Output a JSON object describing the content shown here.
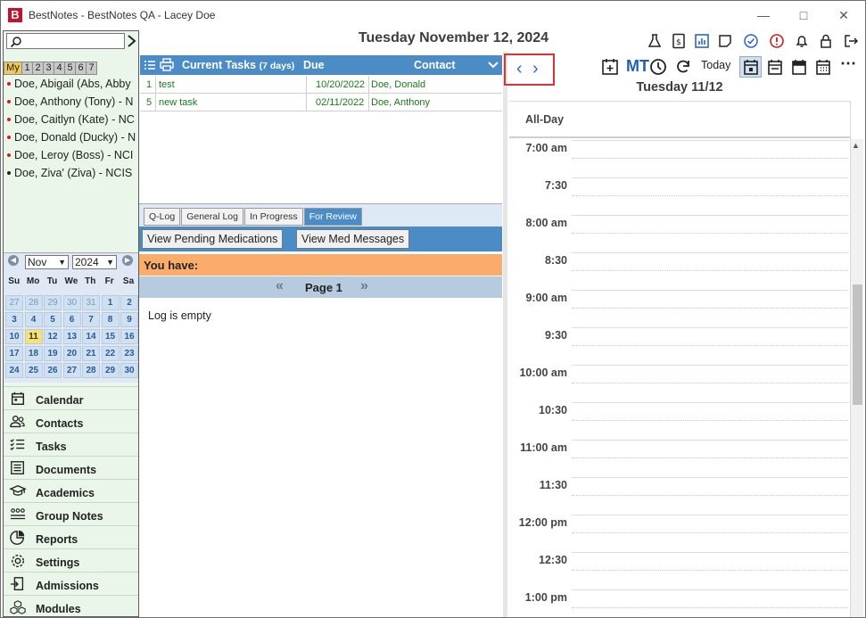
{
  "window": {
    "title": "BestNotes - BestNotes QA - Lacey Doe",
    "logo": "B"
  },
  "header": {
    "date": "Tuesday November 12, 2024",
    "icons": [
      "flask-icon",
      "billing-icon",
      "chart-icon",
      "note-icon",
      "check-circle-icon",
      "info-icon",
      "bell-icon",
      "lock-icon",
      "logout-icon"
    ]
  },
  "sidebar": {
    "search_placeholder": "",
    "tabs": [
      "My",
      "1",
      "2",
      "3",
      "4",
      "5",
      "6",
      "7"
    ],
    "contacts": [
      {
        "name": "Doe, Abigail (Abs, Abby",
        "dot": "#d02020"
      },
      {
        "name": "Doe, Anthony (Tony) - N",
        "dot": "#d02020"
      },
      {
        "name": "Doe, Caitlyn (Kate) - NC",
        "dot": "#d02020"
      },
      {
        "name": "Doe, Donald (Ducky) - N",
        "dot": "#d02020"
      },
      {
        "name": "Doe, Leroy (Boss) - NCI",
        "dot": "#d02020"
      },
      {
        "name": "Doe, Ziva' (Ziva) - NCIS",
        "dot": "#222222"
      }
    ],
    "calendar": {
      "month": "Nov",
      "year": "2024",
      "weekdays": [
        "Su",
        "Mo",
        "Tu",
        "We",
        "Th",
        "Fr",
        "Sa"
      ],
      "days": [
        {
          "d": "27",
          "other": true
        },
        {
          "d": "28",
          "other": true
        },
        {
          "d": "29",
          "other": true
        },
        {
          "d": "30",
          "other": true
        },
        {
          "d": "31",
          "other": true
        },
        {
          "d": "1"
        },
        {
          "d": "2"
        },
        {
          "d": "3"
        },
        {
          "d": "4"
        },
        {
          "d": "5"
        },
        {
          "d": "6"
        },
        {
          "d": "7"
        },
        {
          "d": "8"
        },
        {
          "d": "9"
        },
        {
          "d": "10"
        },
        {
          "d": "11",
          "today": true
        },
        {
          "d": "12"
        },
        {
          "d": "13"
        },
        {
          "d": "14"
        },
        {
          "d": "15"
        },
        {
          "d": "16"
        },
        {
          "d": "17"
        },
        {
          "d": "18"
        },
        {
          "d": "19"
        },
        {
          "d": "20"
        },
        {
          "d": "21"
        },
        {
          "d": "22"
        },
        {
          "d": "23"
        },
        {
          "d": "24"
        },
        {
          "d": "25"
        },
        {
          "d": "26"
        },
        {
          "d": "27"
        },
        {
          "d": "28"
        },
        {
          "d": "29"
        },
        {
          "d": "30"
        }
      ]
    },
    "nav": [
      {
        "label": "Calendar",
        "icon": "calendar-icon"
      },
      {
        "label": "Contacts",
        "icon": "contacts-icon"
      },
      {
        "label": "Tasks",
        "icon": "tasks-icon"
      },
      {
        "label": "Documents",
        "icon": "documents-icon"
      },
      {
        "label": "Academics",
        "icon": "academics-icon"
      },
      {
        "label": "Group Notes",
        "icon": "group-notes-icon"
      },
      {
        "label": "Reports",
        "icon": "reports-icon"
      },
      {
        "label": "Settings",
        "icon": "settings-icon"
      },
      {
        "label": "Admissions",
        "icon": "admissions-icon"
      },
      {
        "label": "Modules",
        "icon": "modules-icon"
      }
    ]
  },
  "tasks": {
    "title": "Current Tasks",
    "subtitle": "(7 days)",
    "col_due": "Due",
    "col_contact": "Contact",
    "rows": [
      {
        "num": "1",
        "name": "test",
        "due": "10/20/2022",
        "contact": "Doe, Donald"
      },
      {
        "num": "5",
        "name": "new task",
        "due": "02/11/2022",
        "contact": "Doe, Anthony"
      }
    ]
  },
  "log": {
    "tabs": [
      "Q-Log",
      "General Log",
      "In Progress",
      "For Review"
    ],
    "active_tab": "For Review",
    "btn_pending": "View Pending Medications",
    "btn_messages": "View Med Messages",
    "you_have": "You have:",
    "page": "Page 1",
    "empty": "Log is empty"
  },
  "calendar_view": {
    "mt_label": "MT",
    "today_label": "Today",
    "day_title": "Tuesday 11/12",
    "allday_label": "All-Day",
    "times": [
      "7:00 am",
      "7:30",
      "8:00 am",
      "8:30",
      "9:00 am",
      "9:30",
      "10:00 am",
      "10:30",
      "11:00 am",
      "11:30",
      "12:00 pm",
      "12:30",
      "1:00 pm"
    ]
  },
  "colors": {
    "accent_blue": "#4b8bc6",
    "highlight_red": "#e03030",
    "orange_bar": "#fbac6b",
    "today_yellow": "#f7e270",
    "task_green": "#1a7a1a"
  }
}
